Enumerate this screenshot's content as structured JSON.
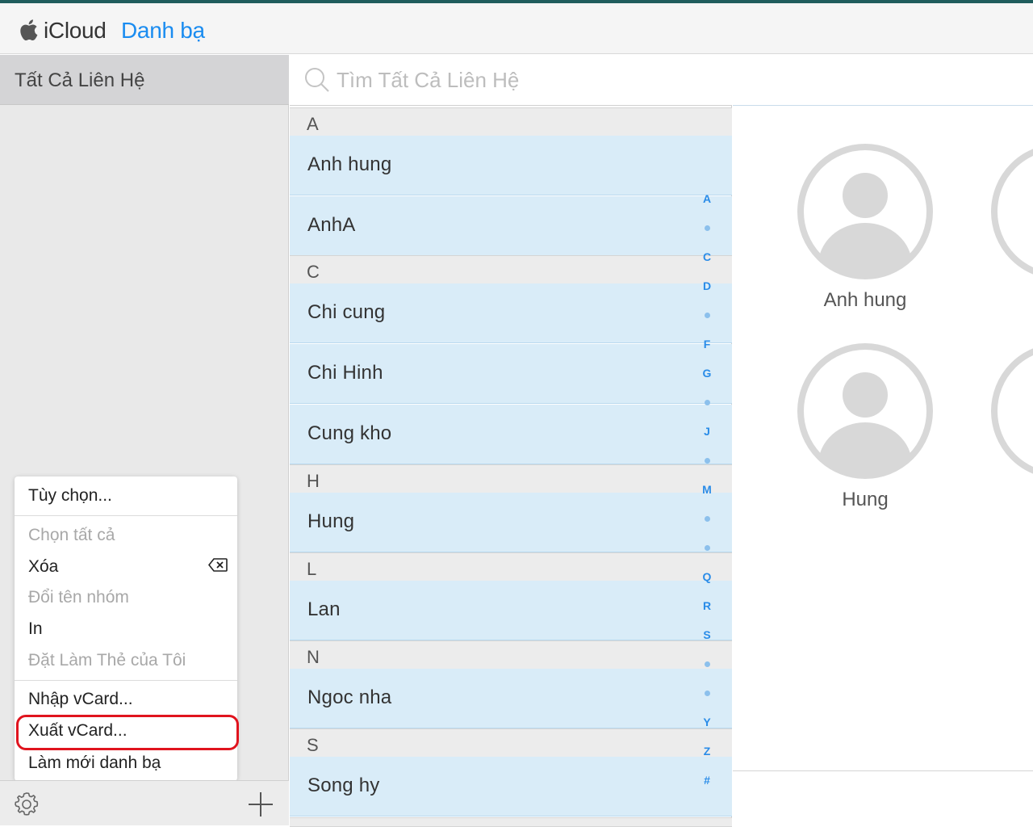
{
  "header": {
    "brand": "iCloud",
    "app_name": "Danh bạ"
  },
  "sidebar": {
    "group": "Tất Cả Liên Hệ"
  },
  "menu": {
    "items": [
      {
        "label": "Tùy chọn...",
        "enabled": true
      },
      {
        "label": "Chọn tất cả",
        "enabled": false
      },
      {
        "label": "Xóa",
        "enabled": true
      },
      {
        "label": "Đổi tên nhóm",
        "enabled": false
      },
      {
        "label": "In",
        "enabled": true
      },
      {
        "label": "Đặt Làm Thẻ của Tôi",
        "enabled": false
      },
      {
        "label": "Nhập vCard...",
        "enabled": true
      },
      {
        "label": "Xuất vCard...",
        "enabled": true,
        "highlighted": true
      },
      {
        "label": "Làm mới danh bạ",
        "enabled": true
      }
    ]
  },
  "search": {
    "placeholder": "Tìm Tất Cả Liên Hệ",
    "value": ""
  },
  "contacts": {
    "sections": [
      {
        "letter": "A",
        "names": [
          "Anh hung",
          "AnhA"
        ]
      },
      {
        "letter": "C",
        "names": [
          "Chi cung",
          "Chi Hinh",
          "Cung kho"
        ]
      },
      {
        "letter": "H",
        "names": [
          "Hung"
        ]
      },
      {
        "letter": "L",
        "names": [
          "Lan"
        ]
      },
      {
        "letter": "N",
        "names": [
          "Ngoc nha"
        ]
      },
      {
        "letter": "S",
        "names": [
          "Song hy"
        ]
      }
    ]
  },
  "index": [
    "A",
    "•",
    "C",
    "D",
    "•",
    "F",
    "G",
    "•",
    "J",
    "•",
    "M",
    "•",
    "•",
    "Q",
    "R",
    "S",
    "•",
    "•",
    "Y",
    "Z",
    "#"
  ],
  "detail": {
    "cards": [
      "Anh hung",
      "Hung"
    ]
  },
  "colors": {
    "accent": "#1a8cf0",
    "selected_row": "#d9ecf8",
    "highlight_ring": "#e0141e"
  }
}
